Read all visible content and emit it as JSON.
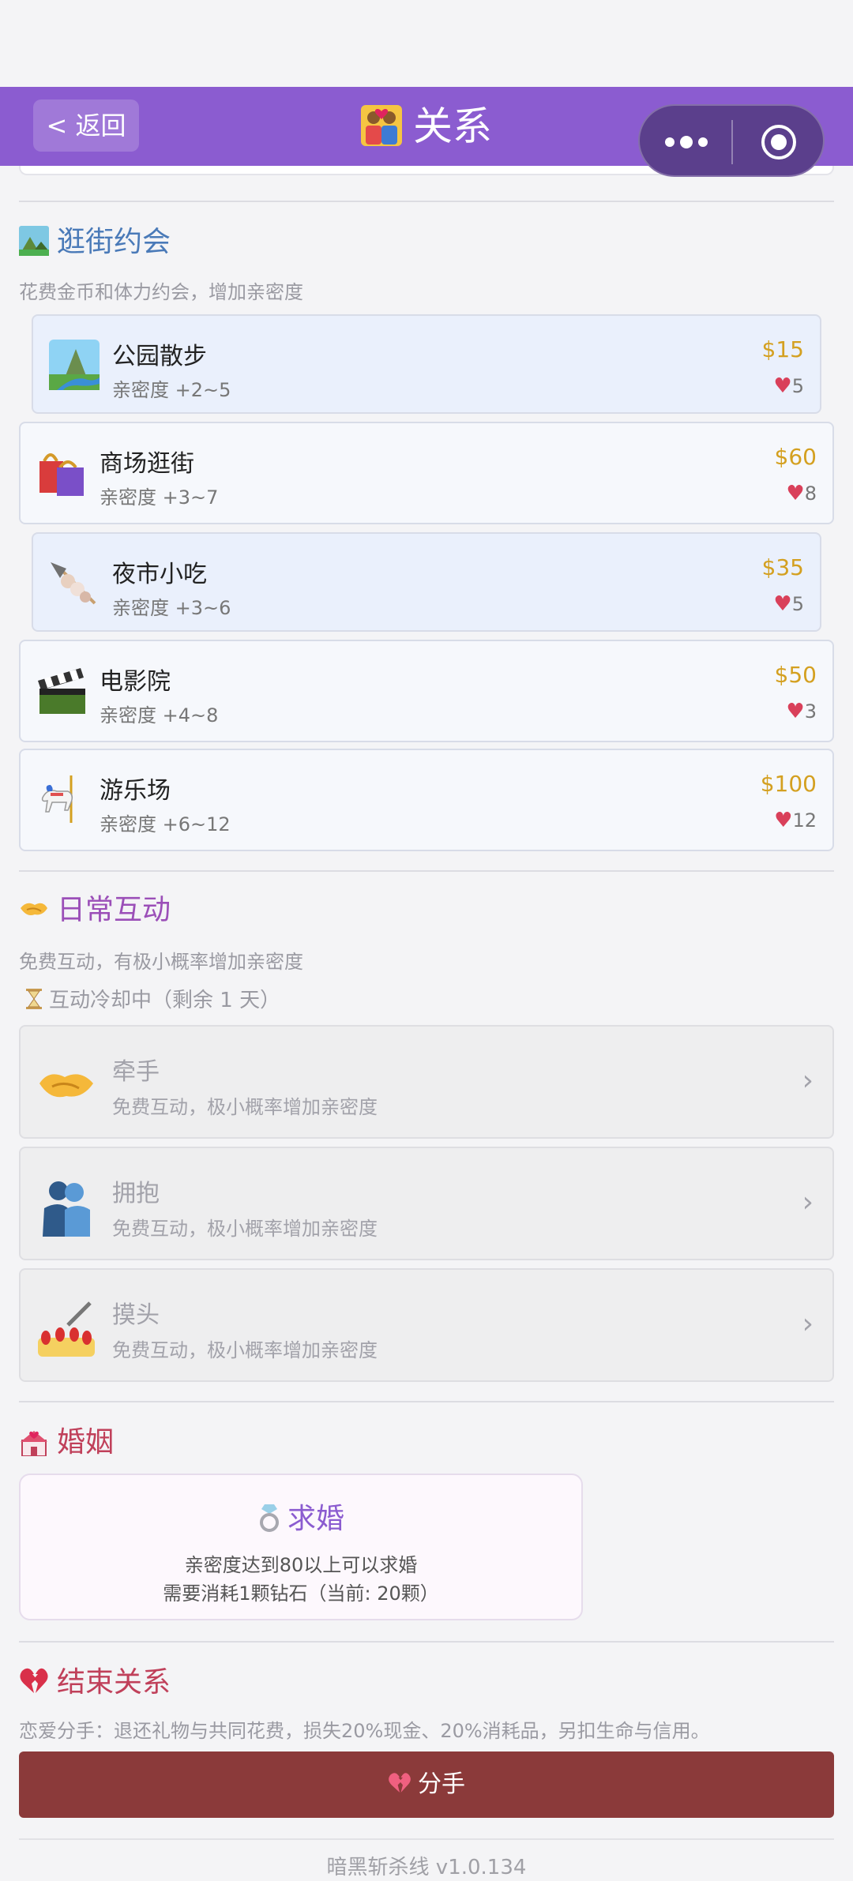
{
  "nav": {
    "back_label": "< 返回",
    "title": "关系"
  },
  "dating": {
    "title": "逛街约会",
    "hint": "花费金币和体力约会，增加亲密度",
    "items": [
      {
        "name": "公园散步",
        "desc": "亲密度 +2~5",
        "price": "$15",
        "stamina": "5",
        "icon": "park-icon"
      },
      {
        "name": "商场逛街",
        "desc": "亲密度 +3~7",
        "price": "$60",
        "stamina": "8",
        "icon": "shopping-bags-icon"
      },
      {
        "name": "夜市小吃",
        "desc": "亲密度 +3~6",
        "price": "$35",
        "stamina": "5",
        "icon": "skewer-icon"
      },
      {
        "name": "电影院",
        "desc": "亲密度 +4~8",
        "price": "$50",
        "stamina": "3",
        "icon": "clapper-icon"
      },
      {
        "name": "游乐场",
        "desc": "亲密度 +6~12",
        "price": "$100",
        "stamina": "12",
        "icon": "carousel-icon"
      }
    ]
  },
  "daily": {
    "title": "日常互动",
    "hint": "免费互动，有极小概率增加亲密度",
    "cooldown": "互动冷却中（剩余 1 天）",
    "items": [
      {
        "name": "牵手",
        "desc": "免费互动，极小概率增加亲密度"
      },
      {
        "name": "拥抱",
        "desc": "免费互动，极小概率增加亲密度"
      },
      {
        "name": "摸头",
        "desc": "免费互动，极小概率增加亲密度"
      }
    ],
    "chevron": "›"
  },
  "marriage": {
    "title": "婚姻",
    "propose_title": "求婚",
    "line1": "亲密度达到80以上可以求婚",
    "line2": "需要消耗1颗钻石（当前: 20颗）"
  },
  "end": {
    "title": "结束关系",
    "hint": "恋爱分手：退还礼物与共同花费，损失20%现金、20%消耗品，另扣生命与信用。",
    "button": "分手"
  },
  "footer": {
    "version": "暗黑斩杀线 v1.0.134"
  },
  "colors": {
    "nav": "#8b5cd0",
    "price": "#d4a020",
    "dating_title": "#4a7ab8",
    "daily_title": "#9b4fb8",
    "marriage_title": "#c0405a",
    "breakup": "#8b3a3a"
  }
}
